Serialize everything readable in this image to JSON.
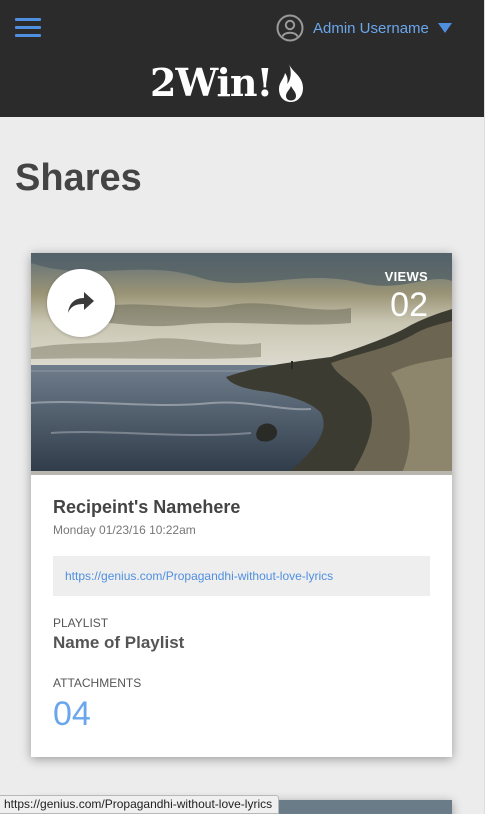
{
  "header": {
    "user_name": "Admin Username",
    "logo_text": "2Win!",
    "icons": {
      "menu": "hamburger-menu-icon",
      "user": "user-circle-icon",
      "dropdown": "caret-down-icon",
      "logo": "flame-icon"
    },
    "accent_color": "#4f8fe0"
  },
  "page": {
    "title": "Shares"
  },
  "card": {
    "views_label": "VIEWS",
    "views_count": "02",
    "recipient": "Recipeint's Namehere",
    "date": "Monday 01/23/16 10:22am",
    "link": "https://genius.com/Propagandhi-without-love-lyrics",
    "playlist_label": "PLAYLIST",
    "playlist_name": "Name of Playlist",
    "attachments_label": "ATTACHMENTS",
    "attachments_count": "04",
    "share_icon": "share-arrow-icon"
  },
  "status_bar": {
    "url": "https://genius.com/Propagandhi-without-love-lyrics"
  }
}
